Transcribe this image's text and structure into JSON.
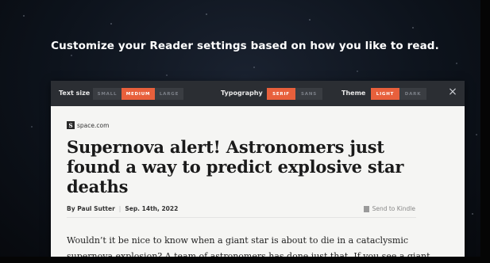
{
  "banner": {
    "headline": "Customize your Reader settings based on how you like to read."
  },
  "toolbar": {
    "text_size": {
      "label": "Text size",
      "options": [
        "SMALL",
        "MEDIUM",
        "LARGE"
      ],
      "selected": "MEDIUM"
    },
    "typography": {
      "label": "Typography",
      "options": [
        "SERIF",
        "SANS"
      ],
      "selected": "SERIF"
    },
    "theme": {
      "label": "Theme",
      "options": [
        "LIGHT",
        "DARK"
      ],
      "selected": "LIGHT"
    },
    "close_icon": "×"
  },
  "article": {
    "source_logo": "S",
    "source": "space.com",
    "title": "Supernova alert! Astronomers just found a way to predict explosive star deaths",
    "author": "By Paul Sutter",
    "date": "Sep. 14th, 2022",
    "send_to_kindle": "Send to Kindle",
    "body_line1": "Wouldn’t it be nice to know when a giant star is about to die in a cataclysmic",
    "body_line2": "supernova explosion? A team of astronomers has done just that. If you see a giant"
  },
  "colors": {
    "accent": "#e8603c",
    "toolbar_bg": "#2b2e33",
    "page_bg": "#f5f5f3"
  }
}
